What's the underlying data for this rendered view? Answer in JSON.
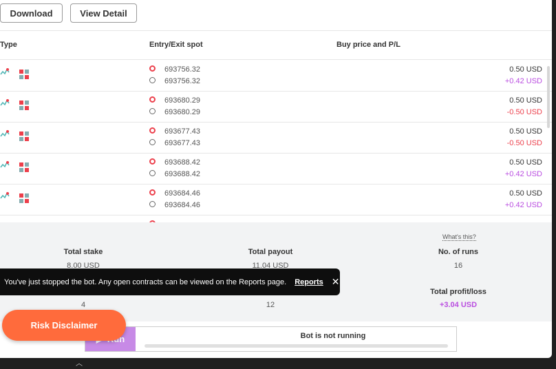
{
  "toolbar": {
    "download_label": "Download",
    "view_detail_label": "View Detail"
  },
  "table": {
    "headers": {
      "type": "Type",
      "entry_exit": "Entry/Exit spot",
      "buy_pl": "Buy price and P/L"
    },
    "rows": [
      {
        "entry": "693756.32",
        "exit": "693756.32",
        "price": "0.50 USD",
        "pl": "+0.42 USD",
        "pl_positive": true
      },
      {
        "entry": "693680.29",
        "exit": "693680.29",
        "price": "0.50 USD",
        "pl": "-0.50 USD",
        "pl_positive": false
      },
      {
        "entry": "693677.43",
        "exit": "693677.43",
        "price": "0.50 USD",
        "pl": "-0.50 USD",
        "pl_positive": false
      },
      {
        "entry": "693688.42",
        "exit": "693688.42",
        "price": "0.50 USD",
        "pl": "+0.42 USD",
        "pl_positive": true
      },
      {
        "entry": "693684.46",
        "exit": "693684.46",
        "price": "0.50 USD",
        "pl": "+0.42 USD",
        "pl_positive": true
      }
    ]
  },
  "summary": {
    "whats_this": "What's this?",
    "total_stake_label": "Total stake",
    "total_stake": "8.00 USD",
    "total_payout_label": "Total payout",
    "total_payout": "11.04 USD",
    "runs_label": "No. of runs",
    "runs": "16",
    "contracts_lost": "4",
    "contracts_won": "12",
    "profit_label": "Total profit/loss",
    "profit": "+3.04 USD"
  },
  "toast": {
    "message": "You've just stopped the bot. Any open contracts can be viewed on the Reports page.",
    "link": "Reports",
    "close": "✕"
  },
  "run": {
    "button_label": "Run",
    "status": "Bot is not running"
  },
  "risk_disclaimer": "Risk Disclaimer",
  "colors": {
    "positive": "#b94ce0",
    "negative": "#ec3f4b",
    "accent": "#ff6b3c"
  }
}
